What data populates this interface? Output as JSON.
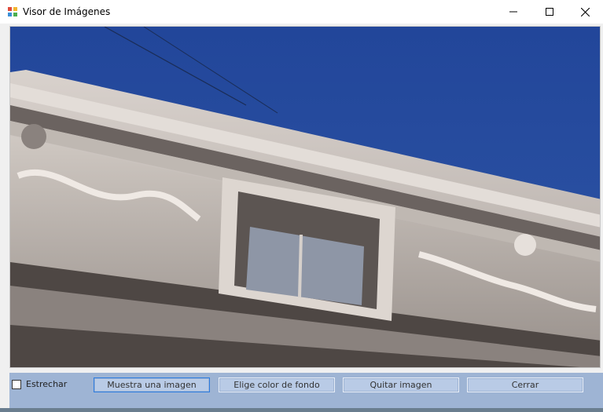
{
  "window": {
    "title": "Visor de Imágenes",
    "controls": [
      "minimize-icon",
      "maximize-icon",
      "close-icon"
    ]
  },
  "picture": {
    "icon": "photo-building-cornice",
    "colors": {
      "sky": "#2a4e9a",
      "stone": "#c9c2bc",
      "shadow": "#5c5552"
    }
  },
  "panel": {
    "background": "#9eb4d4",
    "stretch_checkbox": {
      "label": "Estrechar",
      "checked": false
    },
    "buttons": {
      "show_image": "Muestra una imagen",
      "background_color": "Elige color de fondo",
      "clear_image": "Quitar imagen",
      "close": "Cerrar"
    }
  }
}
